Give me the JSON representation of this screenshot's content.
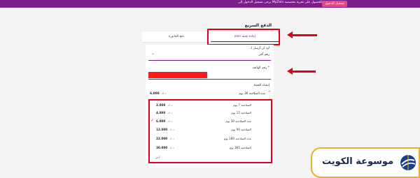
{
  "topbar": {
    "message": "للحصول على تجربة مخصصة MyZain يرجى تسجيل الدخول إلى",
    "login_button": "تسجيل الدخول"
  },
  "page": {
    "title": "الدفع السريع"
  },
  "tabs": [
    {
      "label": "إعادة تعبئة zain",
      "active": true
    },
    {
      "label": "دفع الفاتورة",
      "active": false
    }
  ],
  "form": {
    "target_label": "أود أن أرسل لـ",
    "target_value": "رقم آخر",
    "phone_label": "* رقم الهاتف",
    "pack_label": "إنشاء التعبئة",
    "selected": {
      "name": "مدة الصلاحية 30 يوم",
      "price": "6.000",
      "currency": "د.ك"
    }
  },
  "options": [
    {
      "name": "الصلاحية 7 يوم",
      "price": "2.000",
      "currency": "د.ك",
      "selected": false
    },
    {
      "name": "الصلاحية 15 يوم",
      "price": "4.000",
      "currency": "د.ك",
      "selected": false
    },
    {
      "name": "مدة الصلاحية 30 يوم",
      "price": "6.000",
      "currency": "د.ك",
      "selected": true
    },
    {
      "name": "الصلاحية 90 يوم",
      "price": "12.000",
      "currency": "د.ك",
      "selected": false
    },
    {
      "name": "مدة الصلاحية 180 يوم",
      "price": "22.000",
      "currency": "د.ك",
      "selected": false
    },
    {
      "name": "الصلاحية 365 يوم",
      "price": "30.000",
      "currency": "د.ك",
      "selected": false
    }
  ],
  "other_option": "آخر",
  "watermark": {
    "text": "موسوعة الكويت"
  },
  "colors": {
    "brand": "#7a1f8a",
    "annotation_red": "#e0001a",
    "accent": "#d21a4e"
  }
}
